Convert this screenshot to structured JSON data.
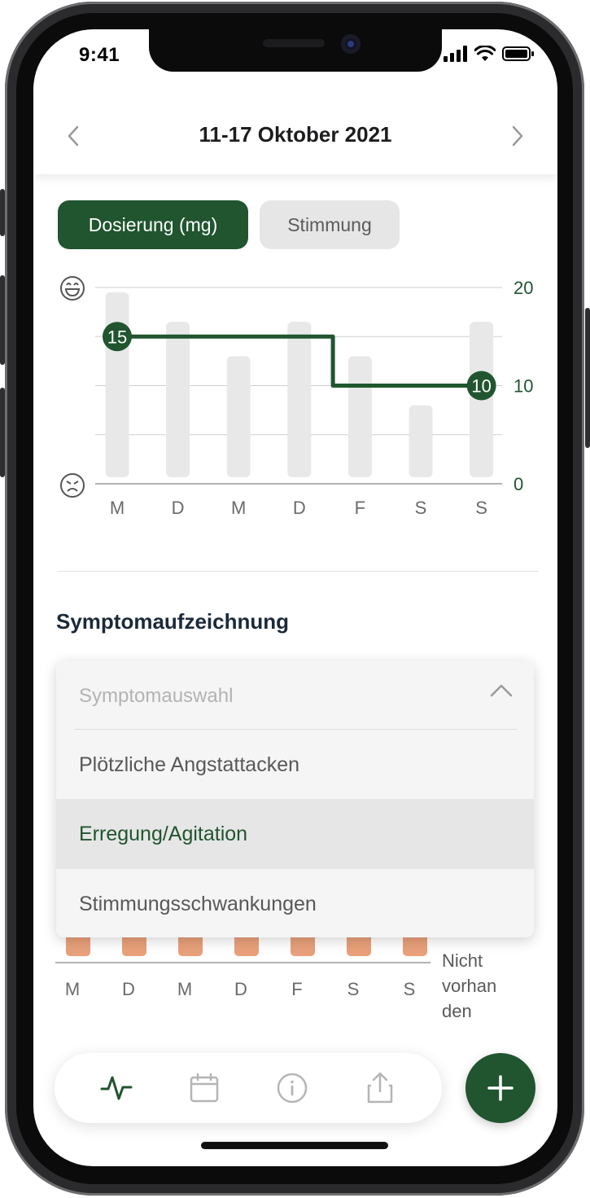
{
  "status_bar": {
    "time": "9:41"
  },
  "header": {
    "title": "11-17 Oktober 2021",
    "prev_icon": "chevron-left-icon",
    "next_icon": "chevron-right-icon"
  },
  "tabs": [
    {
      "label": "Dosierung (mg)",
      "active": true
    },
    {
      "label": "Stimmung",
      "active": false
    }
  ],
  "chart_data": {
    "type": "bar",
    "categories": [
      "M",
      "D",
      "M",
      "D",
      "F",
      "S",
      "S"
    ],
    "series": [
      {
        "name": "",
        "type": "bar",
        "values": [
          19.5,
          16.5,
          13,
          16.5,
          13,
          8,
          16.5
        ]
      },
      {
        "name": "",
        "type": "line",
        "values": [
          15,
          15,
          15,
          15,
          10,
          10,
          10
        ],
        "labels": [
          "15",
          "",
          "",
          "",
          "",
          "",
          "10"
        ]
      }
    ],
    "ylim": [
      0,
      20
    ],
    "y_ticks": [
      "0",
      "10",
      "20"
    ],
    "left_icons": [
      "happy-face-icon",
      "sad-face-icon"
    ],
    "colors": {
      "bar": "#e8e8e8",
      "line": "#20552f"
    },
    "grid": true
  },
  "section": {
    "title": "Symptomaufzeichnung"
  },
  "dropdown": {
    "placeholder": "Symptomauswahl",
    "options": [
      {
        "label": "Plötzliche Angstattacken",
        "selected": false
      },
      {
        "label": "Erregung/Agitation",
        "selected": true
      },
      {
        "label": "Stimmungsschwankungen",
        "selected": false
      }
    ]
  },
  "lower_chart": {
    "categories": [
      "M",
      "D",
      "M",
      "D",
      "F",
      "S",
      "S"
    ],
    "level_label": [
      "Nicht",
      "vorhan",
      "den"
    ],
    "bar_color": "#e8a07a"
  },
  "tabbar": {
    "items": [
      "activity-icon",
      "calendar-icon",
      "info-icon",
      "share-icon"
    ],
    "active": "activity-icon"
  },
  "fab": {
    "icon": "plus-icon"
  },
  "colors": {
    "primary": "#20552f"
  }
}
